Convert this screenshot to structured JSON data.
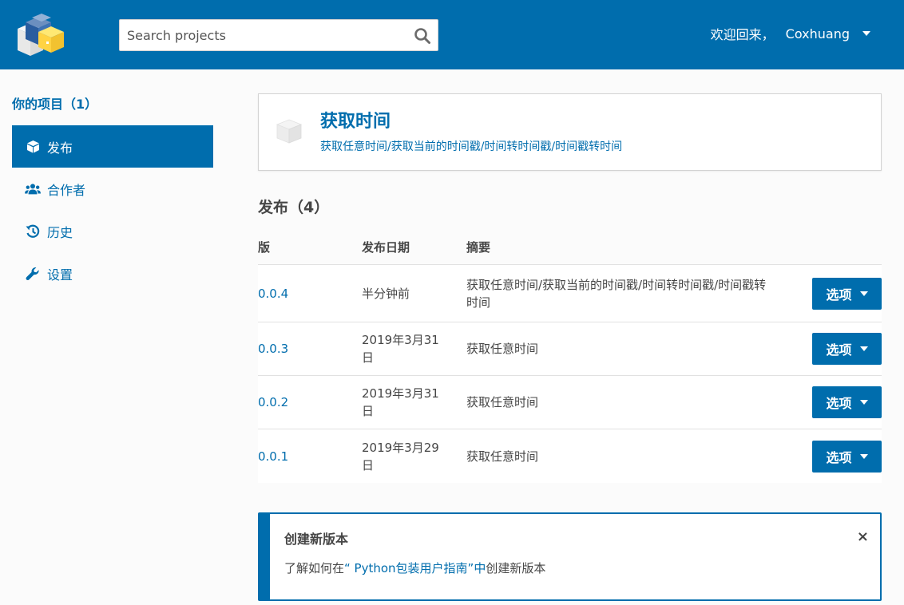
{
  "header": {
    "search_placeholder": "Search projects",
    "greeting": "欢迎回来，",
    "username": "Coxhuang"
  },
  "sidebar": {
    "title": "你的项目（1）",
    "items": [
      {
        "label": "发布",
        "icon": "cube-icon",
        "active": true
      },
      {
        "label": "合作者",
        "icon": "users-icon",
        "active": false
      },
      {
        "label": "历史",
        "icon": "history-icon",
        "active": false
      },
      {
        "label": "设置",
        "icon": "wrench-icon",
        "active": false
      }
    ]
  },
  "project": {
    "name": "获取时间",
    "summary": "获取任意时间/获取当前的时间戳/时间转时间戳/时间戳转时间"
  },
  "releases": {
    "heading": "发布（4）",
    "columns": [
      "版",
      "发布日期",
      "摘要"
    ],
    "rows": [
      {
        "version": "0.0.4",
        "date": "半分钟前",
        "summary": "获取任意时间/获取当前的时间戳/时间转时间戳/时间戳转时间",
        "button": "选项"
      },
      {
        "version": "0.0.3",
        "date": "2019年3月31日",
        "summary": "获取任意时间",
        "button": "选项"
      },
      {
        "version": "0.0.2",
        "date": "2019年3月31日",
        "summary": "获取任意时间",
        "button": "选项"
      },
      {
        "version": "0.0.1",
        "date": "2019年3月29日",
        "summary": "获取任意时间",
        "button": "选项"
      }
    ]
  },
  "callout": {
    "title": "创建新版本",
    "text_before": "了解如何在",
    "link_text": "“ Python包装用户指南”中",
    "text_after": "创建新版本",
    "close": "×"
  },
  "colors": {
    "brand": "#006dad",
    "text": "#464646",
    "background": "#fbfbfb"
  }
}
